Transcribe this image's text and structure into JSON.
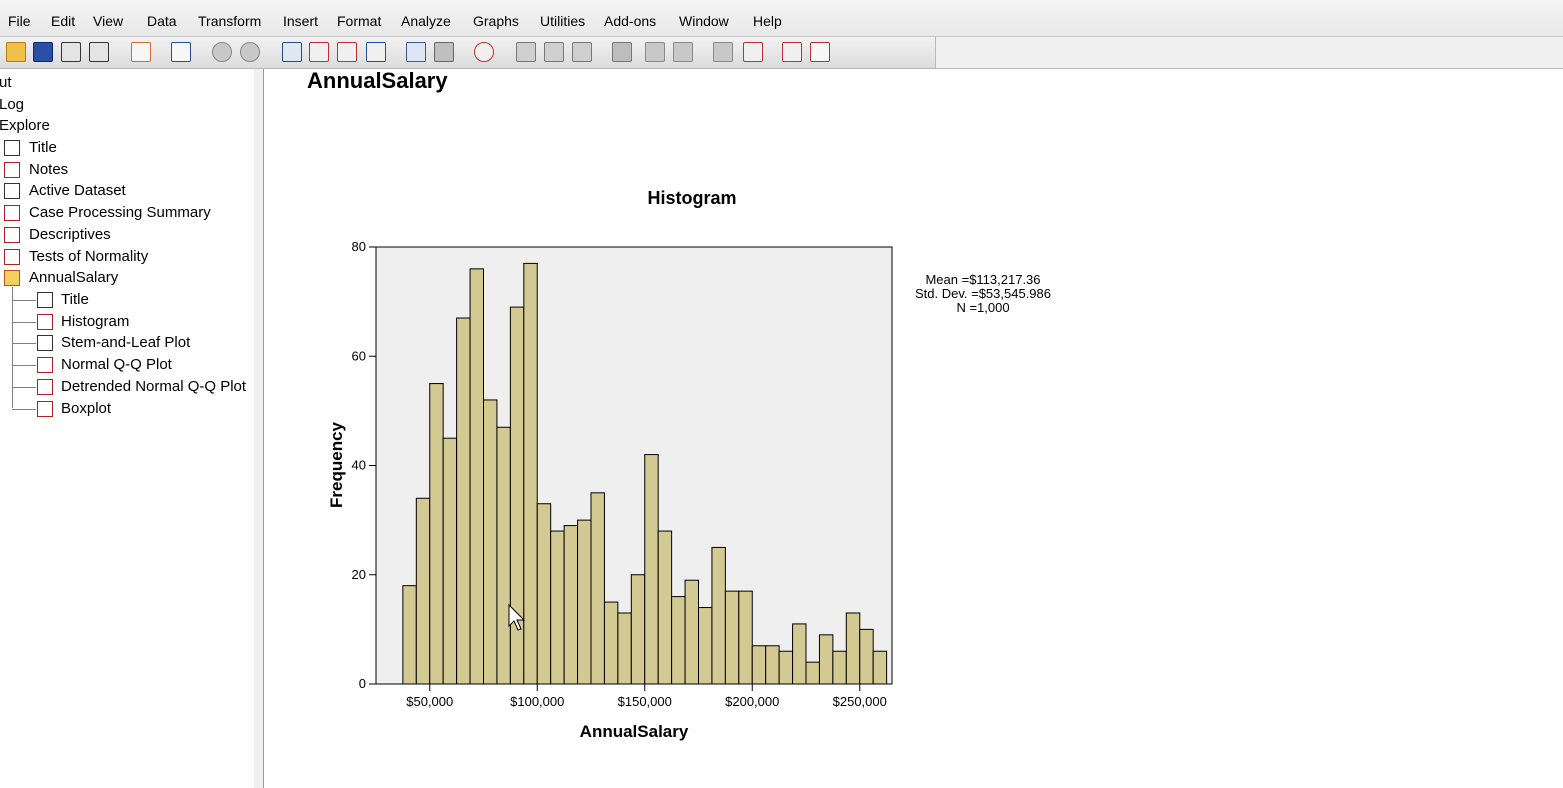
{
  "menu": [
    "File",
    "Edit",
    "View",
    "Data",
    "Transform",
    "Insert",
    "Format",
    "Analyze",
    "Graphs",
    "Utilities",
    "Add-ons",
    "Window",
    "Help"
  ],
  "toolbar_icons": [
    "open-folder-icon",
    "save-icon",
    "print-icon",
    "print-preview-icon",
    "export-icon",
    "dialog-recall-icon",
    "undo-icon",
    "redo-icon",
    "goto-data-icon",
    "goto-case-icon",
    "variables-icon",
    "use-variable-sets-icon",
    "show-all-variables-icon",
    "spell-check-icon",
    "designate-window-icon",
    "select-last-output-icon",
    "promote-icon",
    "demote-icon",
    "expand-icon",
    "collapse-icon",
    "show-icon",
    "hide-icon",
    "insert-heading-icon",
    "insert-title-icon",
    "insert-text-icon"
  ],
  "tree": {
    "root_items": [
      {
        "label": "ut",
        "icon": ""
      },
      {
        "label": "Log",
        "icon": ""
      },
      {
        "label": "Explore",
        "icon": ""
      }
    ],
    "level1_items": [
      {
        "label": "Title",
        "icon": "title-icon"
      },
      {
        "label": "Notes",
        "icon": "notes-icon"
      },
      {
        "label": "Active Dataset",
        "icon": "dataset-icon"
      },
      {
        "label": "Case Processing Summary",
        "icon": "table-icon"
      },
      {
        "label": "Descriptives",
        "icon": "table-icon"
      },
      {
        "label": "Tests of Normality",
        "icon": "table-icon"
      },
      {
        "label": "AnnualSalary",
        "icon": "folder-heading-icon"
      }
    ],
    "level2_items": [
      {
        "label": "Title",
        "icon": "title-icon"
      },
      {
        "label": "Histogram",
        "icon": "chart-icon"
      },
      {
        "label": "Stem-and-Leaf Plot",
        "icon": "text-output-icon"
      },
      {
        "label": "Normal Q-Q Plot",
        "icon": "chart-icon"
      },
      {
        "label": "Detrended Normal Q-Q Plot",
        "icon": "chart-icon"
      },
      {
        "label": "Boxplot",
        "icon": "chart-icon"
      }
    ]
  },
  "output": {
    "heading": "AnnualSalary"
  },
  "chart_data": {
    "type": "bar",
    "title": "Histogram",
    "xlabel": "AnnualSalary",
    "ylabel": "Frequency",
    "xlim": [
      25000,
      265000
    ],
    "ylim": [
      0,
      80
    ],
    "x_ticks": [
      50000,
      100000,
      150000,
      200000,
      250000
    ],
    "x_tick_labels": [
      "$50,000",
      "$100,000",
      "$150,000",
      "$200,000",
      "$250,000"
    ],
    "y_ticks": [
      0,
      20,
      40,
      60,
      80
    ],
    "y_tick_labels": [
      "0",
      "20",
      "40",
      "60",
      "80"
    ],
    "bin_start": 37500,
    "bin_width": 6250,
    "values": [
      18,
      34,
      55,
      45,
      67,
      76,
      52,
      47,
      69,
      77,
      33,
      28,
      29,
      30,
      35,
      15,
      13,
      20,
      42,
      28,
      16,
      19,
      14,
      25,
      17,
      17,
      7,
      7,
      6,
      11,
      4,
      9,
      6,
      13,
      10,
      6
    ],
    "bar_color": "#d3c993",
    "plot_background": "#efefef",
    "stats": [
      "Mean =$113,217.36",
      "Std. Dev. =$53,545.986",
      "N =1,000"
    ]
  }
}
